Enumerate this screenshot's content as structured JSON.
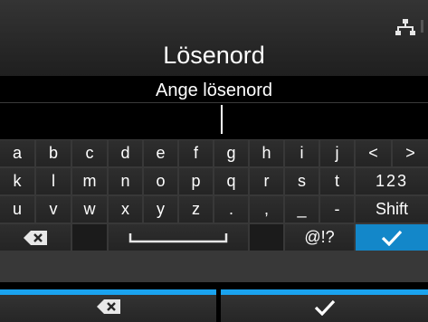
{
  "header": {
    "title": "Lösenord",
    "status_icon": "network-icon"
  },
  "prompt": {
    "text": "Ange lösenord"
  },
  "input": {
    "value": ""
  },
  "keyboard": {
    "row1": [
      "a",
      "b",
      "c",
      "d",
      "e",
      "f",
      "g",
      "h",
      "i",
      "j",
      "<",
      ">"
    ],
    "row2": [
      "k",
      "l",
      "m",
      "n",
      "o",
      "p",
      "q",
      "r",
      "s",
      "t"
    ],
    "row2_mode_label": "123",
    "row3": [
      "u",
      "v",
      "w",
      "x",
      "y",
      "z",
      ".",
      ",",
      "_",
      "-"
    ],
    "row3_shift_label": "Shift",
    "row4": {
      "backspace_icon": "backspace-icon",
      "space_icon": "space-bar-icon",
      "symbols_label": "@!?",
      "confirm_icon": "checkmark-icon"
    }
  },
  "footer": {
    "left_icon": "backspace-icon",
    "right_icon": "checkmark-icon"
  },
  "colors": {
    "accent": "#1aa3ef",
    "confirm_key": "#1387c9",
    "background": "#000000",
    "key": "#2a2a2a"
  }
}
